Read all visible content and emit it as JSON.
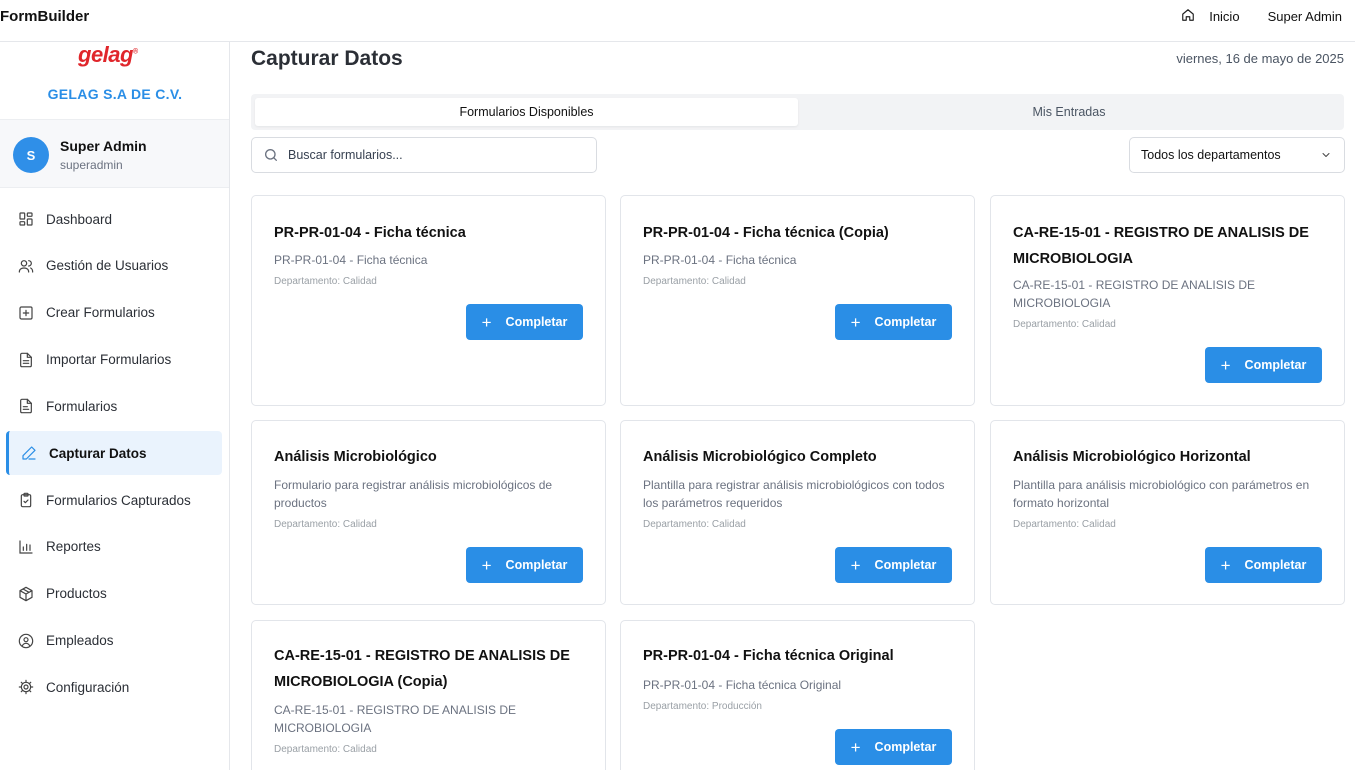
{
  "app": {
    "title": "FormBuilder"
  },
  "topnav": {
    "home_label": "Inicio",
    "user_label": "Super Admin"
  },
  "sidebar": {
    "logo_text": "gelag",
    "logo_mark": "®",
    "company": "GELAG S.A DE C.V.",
    "user": {
      "initial": "S",
      "name": "Super Admin",
      "username": "superadmin"
    },
    "items": [
      {
        "label": "Dashboard",
        "icon": "grid-icon"
      },
      {
        "label": "Gestión de Usuarios",
        "icon": "users-icon"
      },
      {
        "label": "Crear Formularios",
        "icon": "plus-square-icon"
      },
      {
        "label": "Importar Formularios",
        "icon": "file-text-icon"
      },
      {
        "label": "Formularios",
        "icon": "file-icon"
      },
      {
        "label": "Capturar Datos",
        "icon": "pencil-icon",
        "active": true
      },
      {
        "label": "Formularios Capturados",
        "icon": "clipboard-check-icon"
      },
      {
        "label": "Reportes",
        "icon": "bar-chart-icon"
      },
      {
        "label": "Productos",
        "icon": "package-icon"
      },
      {
        "label": "Empleados",
        "icon": "user-circle-icon"
      },
      {
        "label": "Configuración",
        "icon": "gear-icon"
      }
    ]
  },
  "main": {
    "title": "Capturar Datos",
    "date": "viernes, 16 de mayo de 2025",
    "tabs": [
      {
        "label": "Formularios Disponibles",
        "active": true
      },
      {
        "label": "Mis Entradas",
        "active": false
      }
    ],
    "search": {
      "placeholder": "Buscar formularios...",
      "value": ""
    },
    "department_filter": {
      "selected": "Todos los departamentos"
    },
    "complete_label": "Completar",
    "cards": [
      {
        "title": "PR-PR-01-04 - Ficha técnica",
        "description": "PR-PR-01-04 - Ficha técnica",
        "department": "Departamento: Calidad"
      },
      {
        "title": "PR-PR-01-04 - Ficha técnica (Copia)",
        "description": "PR-PR-01-04 - Ficha técnica",
        "department": "Departamento: Calidad"
      },
      {
        "title": "CA-RE-15-01 - REGISTRO DE ANALISIS DE MICROBIOLOGIA",
        "description": "CA-RE-15-01 - REGISTRO DE ANALISIS DE MICROBIOLOGIA",
        "department": "Departamento: Calidad"
      },
      {
        "title": "Análisis Microbiológico",
        "description": "Formulario para registrar análisis microbiológicos de productos",
        "department": "Departamento: Calidad"
      },
      {
        "title": "Análisis Microbiológico Completo",
        "description": "Plantilla para registrar análisis microbiológicos con todos los parámetros requeridos",
        "department": "Departamento: Calidad"
      },
      {
        "title": "Análisis Microbiológico Horizontal",
        "description": "Plantilla para análisis microbiológico con parámetros en formato horizontal",
        "department": "Departamento: Calidad"
      },
      {
        "title": "CA-RE-15-01 - REGISTRO DE ANALISIS DE MICROBIOLOGIA (Copia)",
        "description": "CA-RE-15-01 - REGISTRO DE ANALISIS DE MICROBIOLOGIA",
        "department": "Departamento: Calidad"
      },
      {
        "title": "PR-PR-01-04 - Ficha técnica Original",
        "description": "PR-PR-01-04 - Ficha técnica Original",
        "department": "Departamento: Producción"
      }
    ]
  },
  "colors": {
    "accent": "#2a8ee6",
    "brand": "#e0262b",
    "active_bg": "#eaf3fd"
  }
}
